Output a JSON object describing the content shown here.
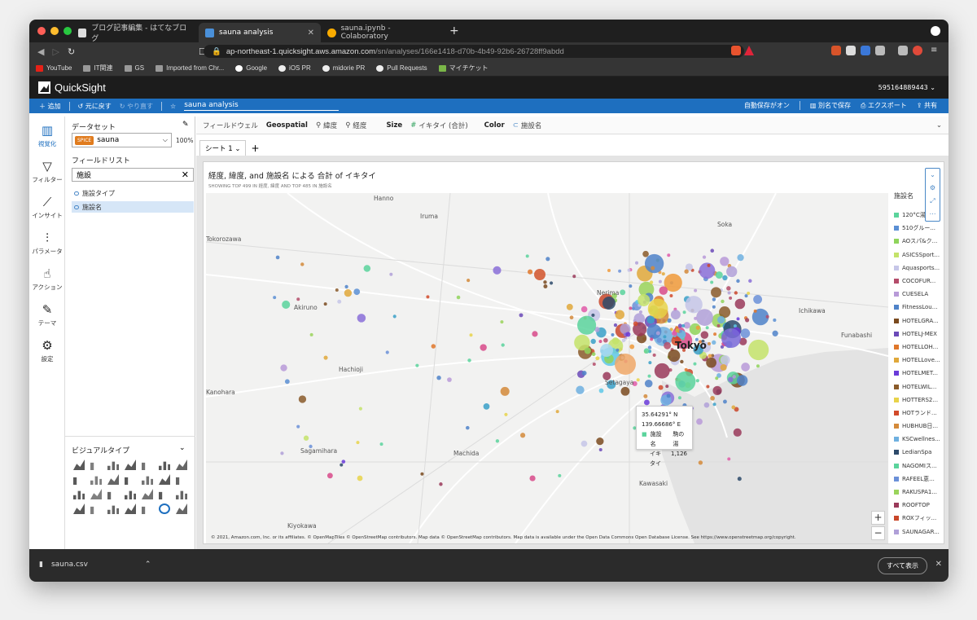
{
  "browser": {
    "tabs": [
      {
        "label": "ブログ記事編集 - はてなブログ",
        "active": false,
        "color": "#dddddd"
      },
      {
        "label": "sauna analysis",
        "active": true,
        "color": "#4a90d9"
      },
      {
        "label": "sauna.ipynb - Colaboratory",
        "active": false,
        "color": "#f9ab00"
      }
    ],
    "url_host": "ap-northeast-1.quicksight.aws.amazon.com",
    "url_path": "/sn/analyses/166e1418-d70b-4b49-92b6-26728ff9abdd",
    "bookmarks": [
      "YouTube",
      "IT関連",
      "GS",
      "Imported from Chr...",
      "Google",
      "iOS PR",
      "midorie PR",
      "Pull Requests",
      "マイチケット"
    ]
  },
  "app": {
    "name": "QuickSight",
    "account": "595164889443"
  },
  "toolbar": {
    "add": "＋ 追加",
    "undo": "元に戻す",
    "redo": "やり直す",
    "analysis_name": "sauna analysis",
    "autosave": "自動保存がオン",
    "save_as": "別名で保存",
    "export": "エクスポート",
    "share": "共有"
  },
  "rail": [
    {
      "label": "視覚化",
      "icon": "bar-chart-icon",
      "glyph": "▥",
      "selected": true
    },
    {
      "label": "フィルター",
      "icon": "filter-icon",
      "glyph": "▽",
      "selected": false
    },
    {
      "label": "インサイト",
      "icon": "insight-icon",
      "glyph": "⟋",
      "selected": false
    },
    {
      "label": "パラメータ",
      "icon": "parameter-icon",
      "glyph": "⫶",
      "selected": false
    },
    {
      "label": "アクション",
      "icon": "action-icon",
      "glyph": "☝",
      "selected": false
    },
    {
      "label": "テーマ",
      "icon": "theme-brush-icon",
      "glyph": "✎",
      "selected": false
    },
    {
      "label": "設定",
      "icon": "settings-gear-icon",
      "glyph": "⚙",
      "selected": false
    }
  ],
  "dataset_panel": {
    "heading": "データセット",
    "spice": "SPICE",
    "dataset": "sauna",
    "percent": "100%",
    "fieldlist_heading": "フィールドリスト",
    "search_value": "施設",
    "fields": [
      "施設タイプ",
      "施設名"
    ],
    "visual_types_heading": "ビジュアルタイプ"
  },
  "fieldwell": {
    "label": "フィールドウェル",
    "geospatial_label": "Geospatial",
    "geo_lat": "緯度",
    "geo_lon": "経度",
    "size_label": "Size",
    "size_value": "イキタイ (合計)",
    "color_label": "Color",
    "color_value": "施設名"
  },
  "sheet": {
    "tab": "シート 1",
    "add": "+"
  },
  "visual": {
    "title": "経度, 緯度, and 施設名 による 合計 of イキタイ",
    "subtitle": "SHOWING TOP 499 IN 経度, 緯度 AND TOP 485 IN 施設名",
    "attribution": "© 2021, Amazon.com, Inc. or its affiliates. © OpenMapTiles © OpenStreetMap contributors. Map data © OpenStreetMap contributors. Map data is available under the Open Data Commons Open Database License. See https://www.openstreetmap.org/copyright.",
    "tooltip": {
      "lat": "35.64291° N",
      "lon": "139.66686° E",
      "name_key": "施設名",
      "name_val": "駒の湯",
      "ikitai_key": "イキタイ",
      "ikitai_val": "1,126"
    },
    "places": [
      "Hanno",
      "Iruma",
      "Soka",
      "Tokorozawa",
      "Akiruno",
      "Nerima",
      "Ichikawa",
      "Funabashi",
      "Tokyo",
      "Hachioji",
      "Setagaya",
      "Sagamihara",
      "Machida",
      "Kawasaki",
      "Kiyokawa",
      "Kanohara"
    ],
    "legend_title": "施設名",
    "legend": [
      {
        "label": "120°C湯...",
        "color": "#5bd49c"
      },
      {
        "label": "510グルー...",
        "color": "#5b8fd4"
      },
      {
        "label": "AOスパ&ク...",
        "color": "#8fd45b"
      },
      {
        "label": "ASICSSport...",
        "color": "#c4e36a"
      },
      {
        "label": "Aquasports...",
        "color": "#c6c6e8"
      },
      {
        "label": "COCOFUR...",
        "color": "#b44c6a"
      },
      {
        "label": "CUESELA",
        "color": "#b89ad8"
      },
      {
        "label": "FitnessLou...",
        "color": "#4f83c9"
      },
      {
        "label": "HOTELGRA...",
        "color": "#7a4a1e"
      },
      {
        "label": "HOTELJ-MEX",
        "color": "#6b4ab8"
      },
      {
        "label": "HOTELLOH...",
        "color": "#e0772a"
      },
      {
        "label": "HOTELLove...",
        "color": "#e0a83a"
      },
      {
        "label": "HOTELMET...",
        "color": "#6a3bd9"
      },
      {
        "label": "HOTELWIL...",
        "color": "#8a5b2a"
      },
      {
        "label": "HOTTERS2...",
        "color": "#e8d34a"
      },
      {
        "label": "HOTランド...",
        "color": "#d24a2a"
      },
      {
        "label": "HUBHUB日...",
        "color": "#d48a3a"
      },
      {
        "label": "KSCwellnes...",
        "color": "#6fb0e0"
      },
      {
        "label": "LedianSpa",
        "color": "#2d4a6a"
      },
      {
        "label": "NAGOMIス...",
        "color": "#5bd49c"
      },
      {
        "label": "RAFEEL恵...",
        "color": "#6b90d8"
      },
      {
        "label": "RAKUSPA1...",
        "color": "#9ad45b"
      },
      {
        "label": "ROOFTOP",
        "color": "#9a3a5a"
      },
      {
        "label": "ROXフィッ...",
        "color": "#c9472a"
      },
      {
        "label": "SAUNAGAR...",
        "color": "#b0a0d8"
      },
      {
        "label": "SOLASPA...",
        "color": "#4f83c9"
      }
    ]
  },
  "download": {
    "file": "sauna.csv",
    "show_all": "すべて表示"
  }
}
